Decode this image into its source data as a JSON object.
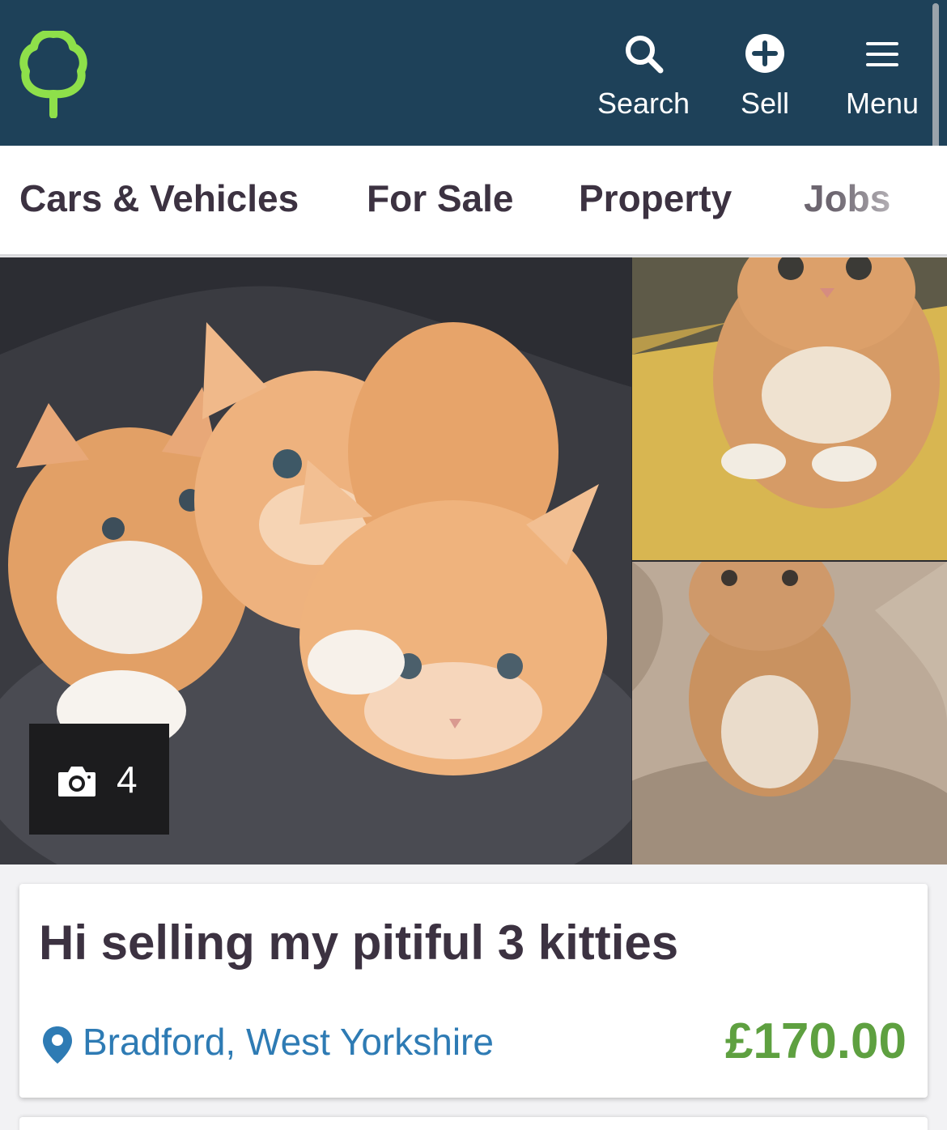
{
  "header": {
    "search_label": "Search",
    "sell_label": "Sell",
    "menu_label": "Menu",
    "bg_color": "#1e4159",
    "logo_color": "#8ee04a"
  },
  "categories": [
    {
      "label": "Cars & Vehicles"
    },
    {
      "label": "For Sale"
    },
    {
      "label": "Property"
    },
    {
      "label": "Jobs"
    }
  ],
  "gallery": {
    "photo_count": "4",
    "icons": [
      "camera-icon"
    ]
  },
  "listing": {
    "title": "Hi selling my pitiful 3 kitties",
    "location": "Bradford, West Yorkshire",
    "price": "£170.00",
    "price_color": "#5ea040",
    "location_color": "#2e7bb4"
  }
}
